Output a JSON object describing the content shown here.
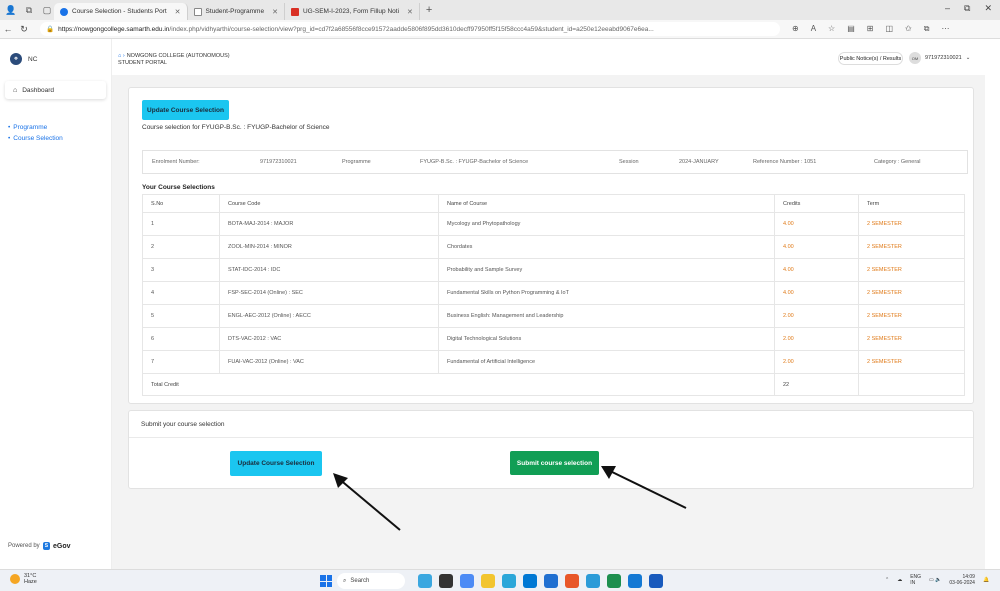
{
  "browser": {
    "tabs": [
      {
        "title": "Course Selection - Students Port",
        "active": true,
        "color": "#1a73e8"
      },
      {
        "title": "Student-Programme",
        "active": false,
        "color": "#888888"
      },
      {
        "title": "UG-SEM-I-2023, Form Fillup Noti",
        "active": false,
        "color": "#d93025"
      }
    ],
    "url_host": "https://nowgongcollege.samarth.edu.in",
    "url_path": "/index.php/vidhyarthi/course-selection/view?prg_id=cd7f2a68556f8cce91572aadde5806f895dd3610decff97950ff5f15f58ccc4a59&student_id=a250e12eeabd9067e6ea..."
  },
  "sidebar": {
    "brand": "NC",
    "dashboard_label": "Dashboard",
    "links": [
      "Programme",
      "Course Selection"
    ],
    "powered_by": "Powered by",
    "powered_brand": "eGov"
  },
  "header": {
    "institution": "NOWGONG COLLEGE (AUTONOMOUS)",
    "portal": "STUDENT PORTAL",
    "notices_label": "Public Notice(s) / Results",
    "user_initials": "OM",
    "user_id": "971972310021"
  },
  "course_card": {
    "update_button": "Update Course Selection",
    "subtitle": "Course selection for FYUGP-B.Sc. : FYUGP-Bachelor of Science",
    "info": {
      "enrolment_label": "Enrolment Number:",
      "enrolment_value": "971972310021",
      "programme_label": "Programme",
      "programme_value": "FYUGP-B.Sc. : FYUGP-Bachelor of Science",
      "session_label": "Session",
      "session_value": "2024-JANUARY",
      "reference": "Reference Number : 1051",
      "category": "Category : General"
    },
    "section_title": "Your Course Selections",
    "columns": [
      "S.No",
      "Course Code",
      "Name of Course",
      "Credits",
      "Term"
    ],
    "rows": [
      {
        "sno": "1",
        "code": "BOTA-MAJ-2014 : MAJOR",
        "name": "Mycology and Phytopathology",
        "credits": "4.00",
        "term": "2 SEMESTER"
      },
      {
        "sno": "2",
        "code": "ZOOL-MIN-2014 : MINOR",
        "name": "Chordates",
        "credits": "4.00",
        "term": "2 SEMESTER"
      },
      {
        "sno": "3",
        "code": "STAT-IDC-2014 : IDC",
        "name": "Probability and Sample Survey",
        "credits": "4.00",
        "term": "2 SEMESTER"
      },
      {
        "sno": "4",
        "code": "FSP-SEC-2014 (Online) : SEC",
        "name": "Fundamental Skills on Python Programming & IoT",
        "credits": "4.00",
        "term": "2 SEMESTER"
      },
      {
        "sno": "5",
        "code": "ENGL-AEC-2012 (Online) : AECC",
        "name": "Business English: Management and Leadership",
        "credits": "2.00",
        "term": "2 SEMESTER"
      },
      {
        "sno": "6",
        "code": "DTS-VAC-2012 : VAC",
        "name": "Digital Technological Solutions",
        "credits": "2.00",
        "term": "2 SEMESTER"
      },
      {
        "sno": "7",
        "code": "FUAI-VAC-2012 (Online) : VAC",
        "name": "Fundamental of Artificial Intelligence",
        "credits": "2.00",
        "term": "2 SEMESTER"
      }
    ],
    "total_label": "Total Credit",
    "total_value": "22"
  },
  "submit_card": {
    "label": "Submit your course selection",
    "update_button": "Update Course Selection",
    "submit_button": "Submit course selection"
  },
  "taskbar": {
    "temp": "31°C",
    "weather": "Haze",
    "search": "Search",
    "lang": "ENG",
    "lang_sub": "IN",
    "time": "14:09",
    "date": "03-06-2024"
  },
  "colors": {
    "accent_cyan": "#1bc6f0",
    "accent_green": "#119e55",
    "link_blue": "#1a73e8",
    "credit_orange": "#e07b1a"
  }
}
